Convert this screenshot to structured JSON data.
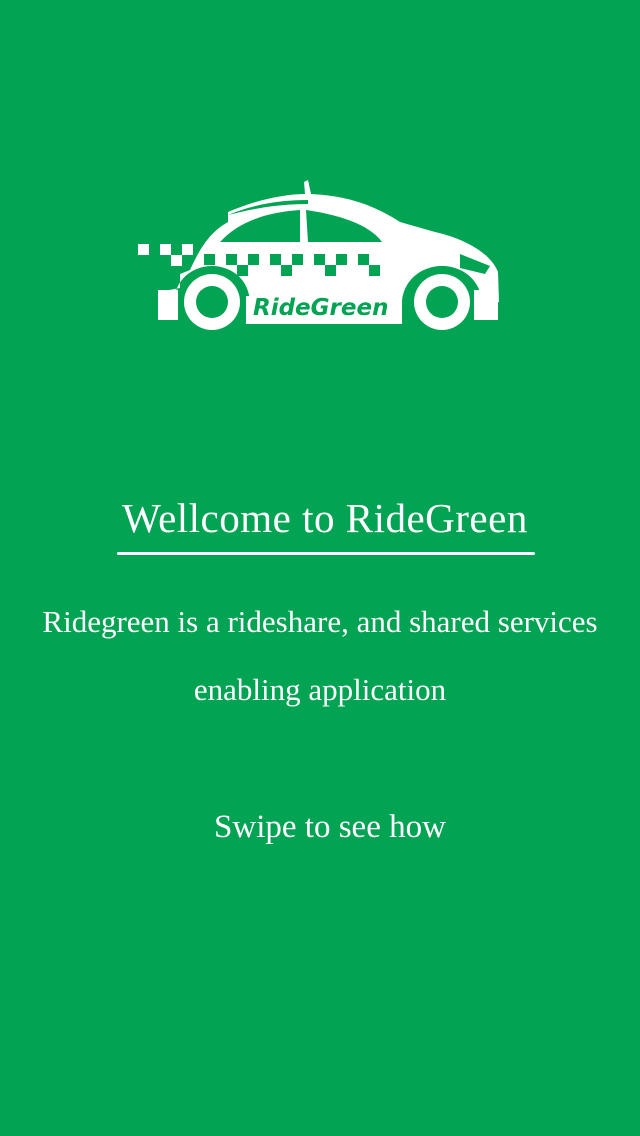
{
  "brand": {
    "logo_text": "RideGreen",
    "background_color": "#02a352",
    "foreground_color": "#ffffff"
  },
  "welcome": {
    "title": "Wellcome to RideGreen",
    "description": "Ridegreen is a rideshare, and shared services enabling application",
    "swipe_hint": "Swipe to see how"
  },
  "icons": {
    "logo": "taxi-car-icon"
  }
}
